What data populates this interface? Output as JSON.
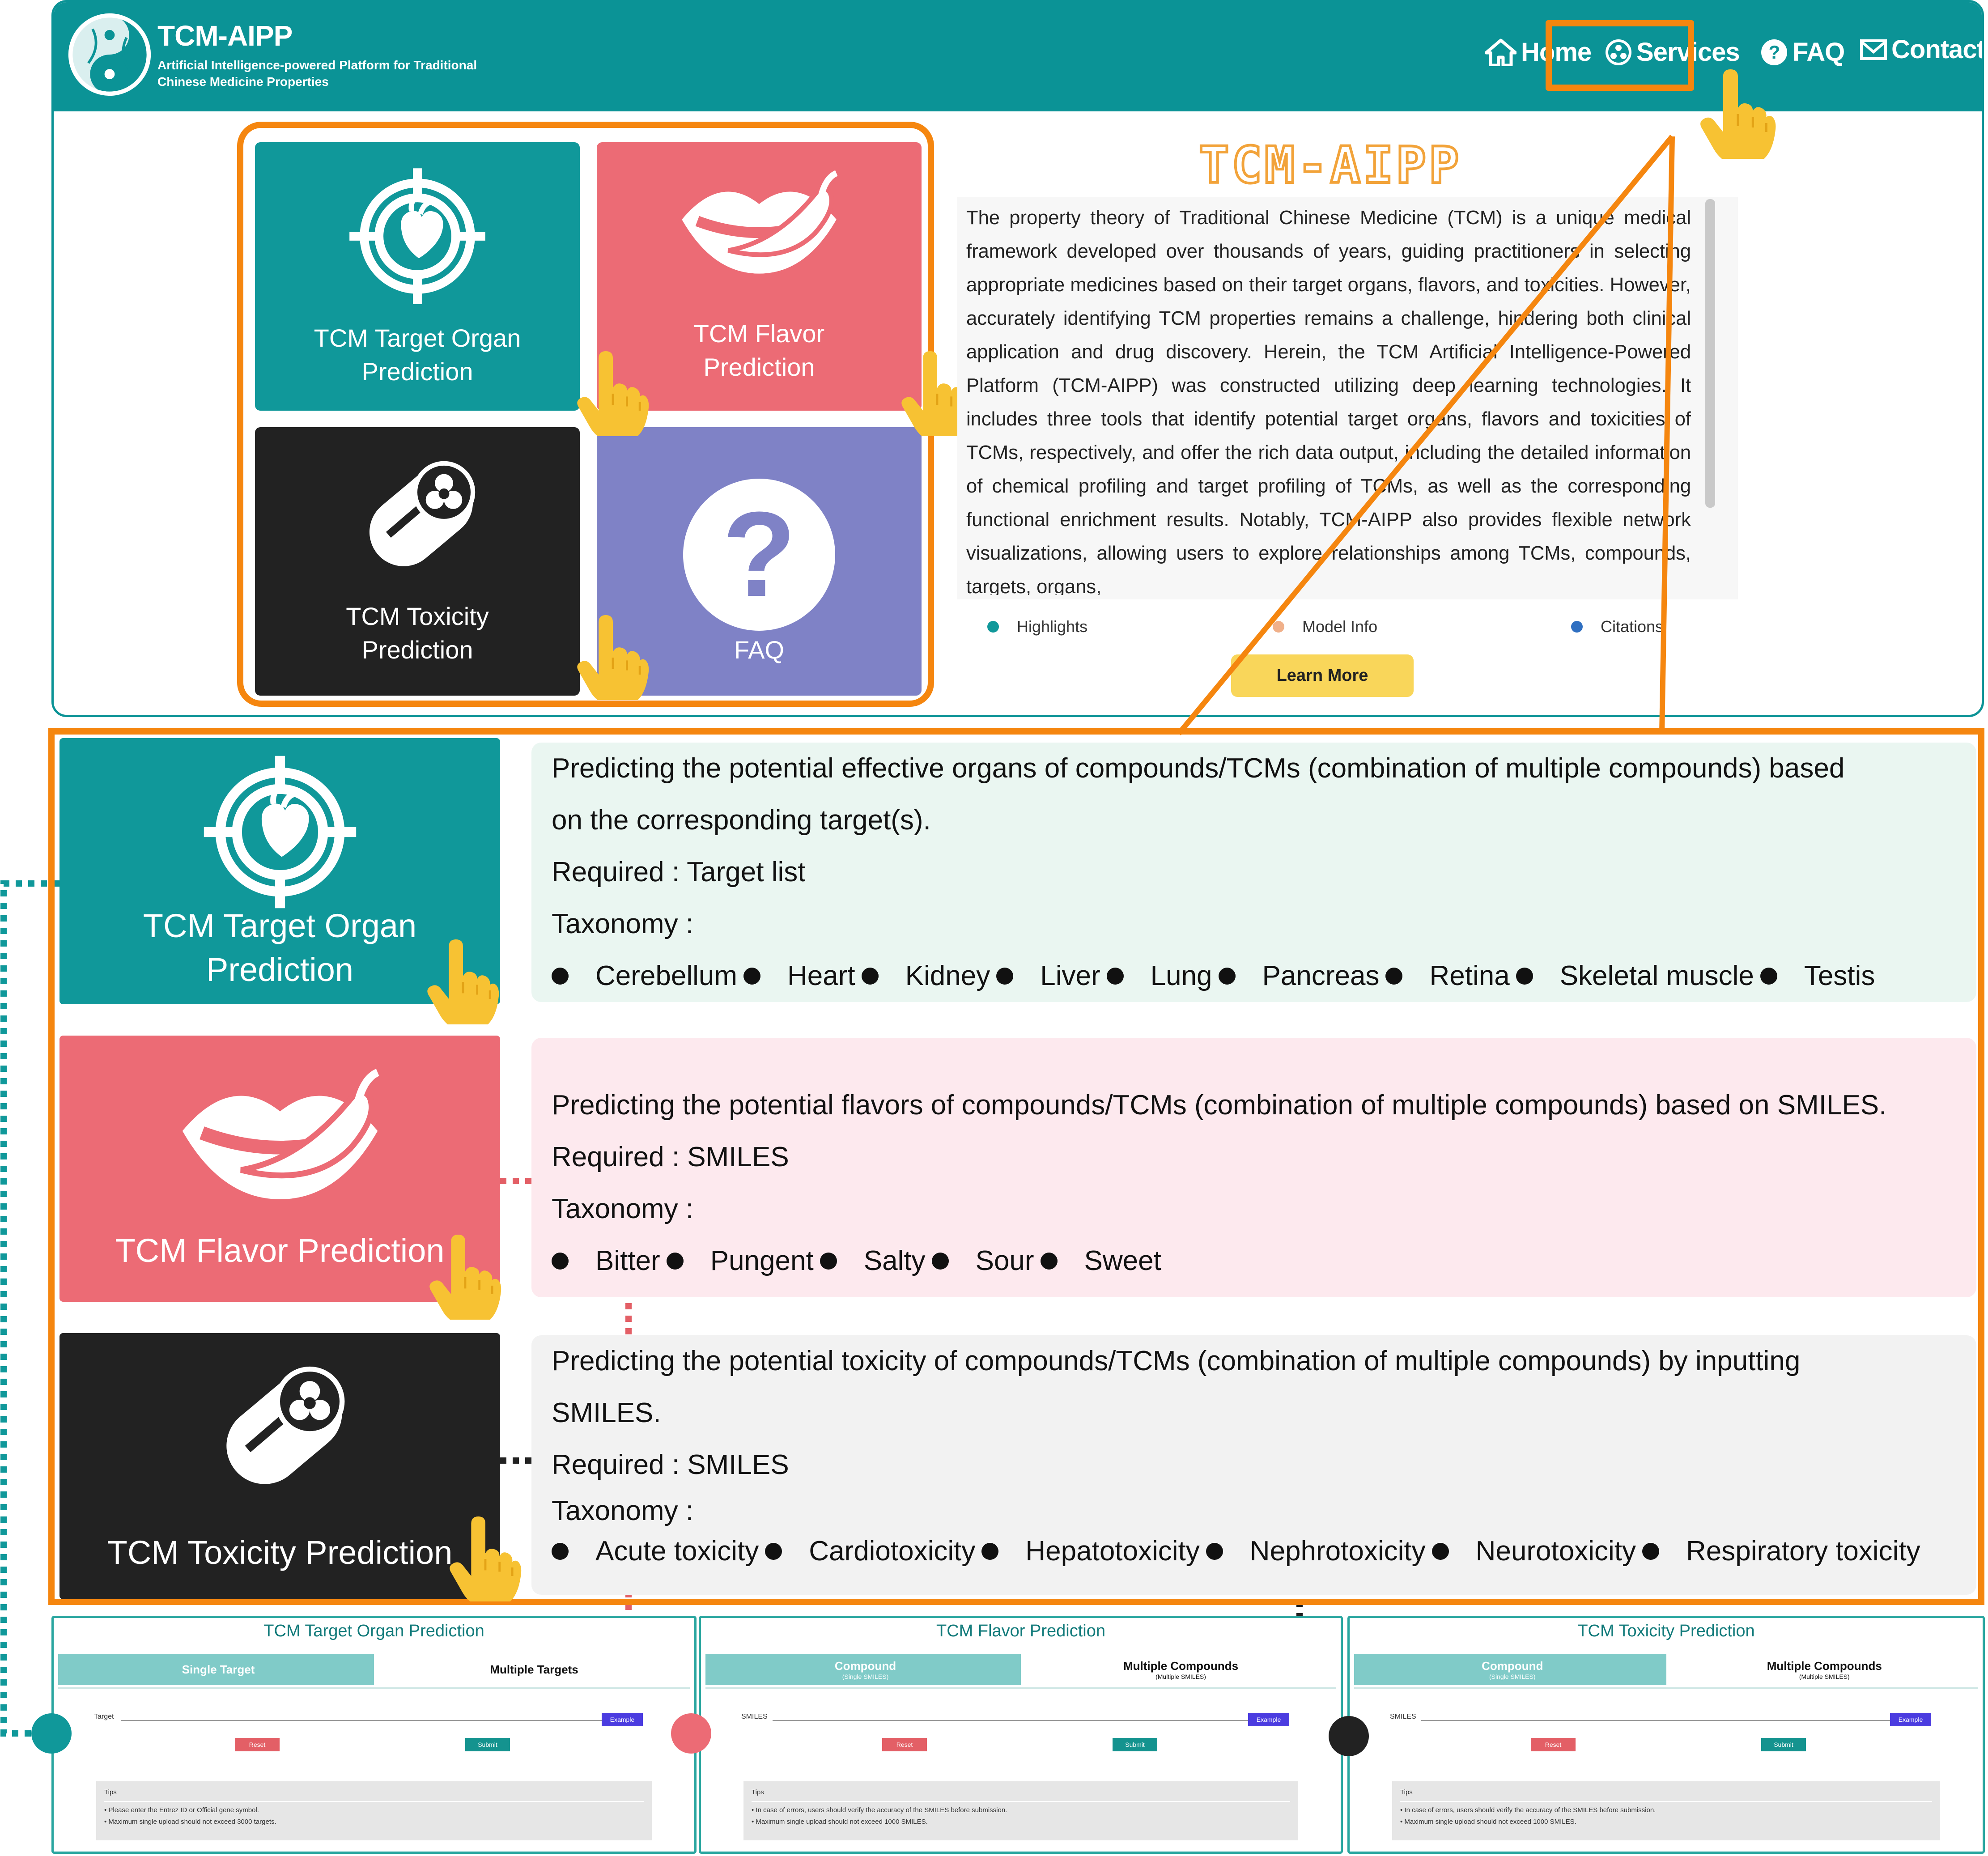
{
  "navbar": {
    "brand": "TCM-AIPP",
    "brand_subtitle": "Artificial Intelligence-powered Platform for Traditional Chinese Medicine Properties",
    "items": [
      {
        "label": "Home",
        "icon": "home-icon"
      },
      {
        "label": "Services",
        "icon": "services-icon"
      },
      {
        "label": "FAQ",
        "icon": "question-icon"
      },
      {
        "label": "Contact",
        "icon": "mail-icon"
      }
    ]
  },
  "tiles": {
    "organ": "TCM Target Organ Prediction",
    "flavor": "TCM Flavor Prediction",
    "toxicity": "TCM Toxicity Prediction",
    "faq": "FAQ"
  },
  "about": {
    "title": "TCM-AIPP",
    "text": "The property theory of Traditional Chinese Medicine (TCM) is a unique medical framework developed over thousands of years, guiding practitioners in selecting appropriate medicines based on their target organs, flavors, and toxicities. However, accurately identifying TCM properties remains a challenge, hindering both clinical application and drug discovery. Herein, the TCM Artificial Intelligence-Powered Platform (TCM-AIPP) was constructed utilizing deep learning technologies. It includes three tools that identify potential target organs, flavors and toxicities of TCMs, respectively, and offer the rich data output, including the detailed information of chemical profiling and target profiling of TCMs, as well as the corresponding functional enrichment results. Notably, TCM-AIPP also provides flexible network visualizations, allowing users to explore relationships among TCMs, compounds, targets, organs,",
    "tabs": [
      {
        "label": "Highlights",
        "color": "#10989a"
      },
      {
        "label": "Model Info",
        "color": "#f0b08a"
      },
      {
        "label": "Citations",
        "color": "#2f6fc1"
      }
    ],
    "button": "Learn More"
  },
  "services": [
    {
      "tile_label": "TCM Target Organ Prediction",
      "description": "Predicting the potential effective organs of compounds/TCMs (combination of multiple compounds) based on the corresponding target(s).",
      "required": "Required : Target list",
      "taxonomy_label": "Taxonomy :",
      "taxonomy": [
        "Cerebellum",
        "Heart",
        "Kidney",
        "Liver",
        "Lung",
        "Pancreas",
        "Retina",
        "Skeletal muscle",
        "Testis"
      ]
    },
    {
      "tile_label": "TCM Flavor Prediction",
      "description": "Predicting the potential flavors of compounds/TCMs (combination of multiple compounds) based on SMILES.",
      "required": "Required : SMILES",
      "taxonomy_label": "Taxonomy :",
      "taxonomy": [
        "Bitter",
        "Pungent",
        "Salty",
        "Sour",
        "Sweet"
      ]
    },
    {
      "tile_label": "TCM Toxicity Prediction",
      "description": "Predicting the potential toxicity of compounds/TCMs (combination of multiple compounds) by inputting SMILES.",
      "required": "Required : SMILES",
      "taxonomy_label": "Taxonomy :",
      "taxonomy": [
        "Acute toxicity",
        "Cardiotoxicity",
        "Hepatotoxicity",
        "Nephrotoxicity",
        "Neurotoxicity",
        "Respiratory toxicity"
      ]
    }
  ],
  "previews": [
    {
      "title": "TCM Target Organ Prediction",
      "tab_a": "Single Target",
      "tab_a_sub": "",
      "tab_b": "Multiple Targets",
      "tab_b_sub": "",
      "field_label": "Target",
      "example": "Example",
      "reset": "Reset",
      "submit": "Submit",
      "tips_title": "Tips",
      "tips": [
        "Please enter the Entrez ID or Official gene symbol.",
        "Maximum single upload should not exceed 3000 targets."
      ]
    },
    {
      "title": "TCM Flavor Prediction",
      "tab_a": "Compound",
      "tab_a_sub": "(Single SMILES)",
      "tab_b": "Multiple Compounds",
      "tab_b_sub": "(Multiple SMILES)",
      "field_label": "SMILES",
      "example": "Example",
      "reset": "Reset",
      "submit": "Submit",
      "tips_title": "Tips",
      "tips": [
        "In case of errors, users should verify the accuracy of the SMILES before submission.",
        "Maximum single upload should not exceed 1000 SMILES."
      ]
    },
    {
      "title": "TCM Toxicity Prediction",
      "tab_a": "Compound",
      "tab_a_sub": "(Single SMILES)",
      "tab_b": "Multiple Compounds",
      "tab_b_sub": "(Multiple SMILES)",
      "field_label": "SMILES",
      "example": "Example",
      "reset": "Reset",
      "submit": "Submit",
      "tips_title": "Tips",
      "tips": [
        "In case of errors, users should verify the accuracy of the SMILES before submission.",
        "Maximum single upload should not exceed 1000 SMILES."
      ]
    }
  ],
  "colors": {
    "teal": "#0b9396",
    "flavor_red": "#ec6b75",
    "toxicity_black": "#222222",
    "faq_purple": "#7f82c6",
    "highlight_orange": "#f5860f",
    "button_yellow": "#f9d65a",
    "cursor_yellow": "#f7c233"
  }
}
